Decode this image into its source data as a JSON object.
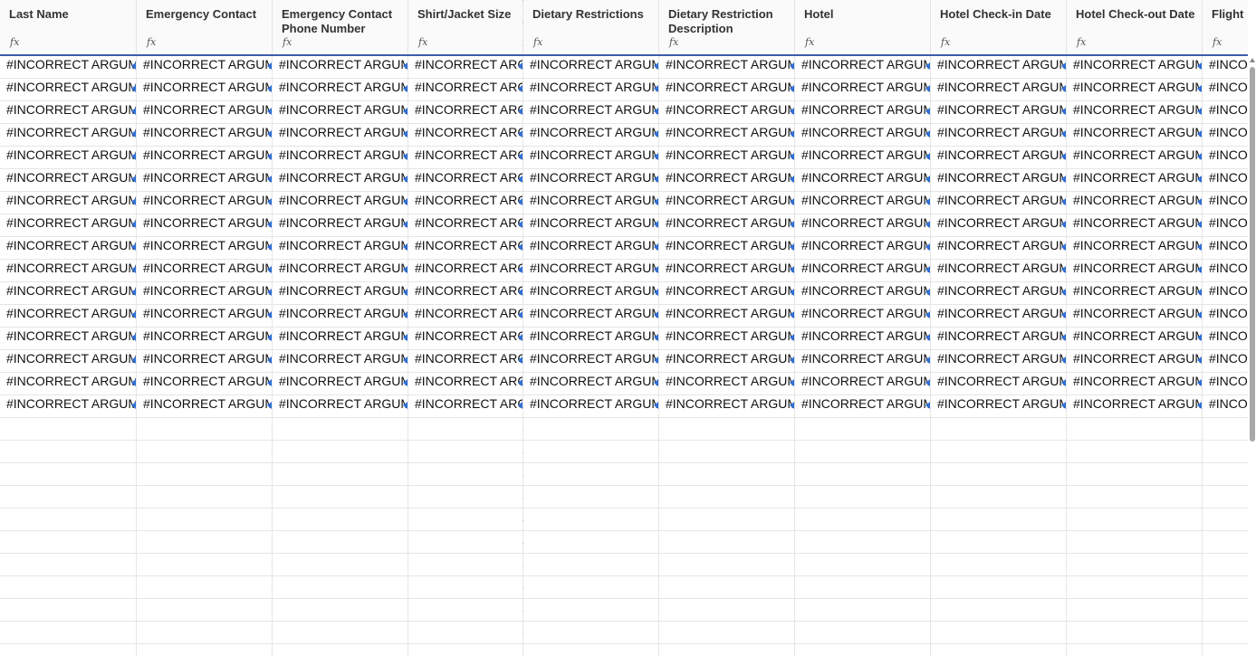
{
  "columns": [
    {
      "label": "Last Name",
      "fx": "fx"
    },
    {
      "label": "Emergency Contact",
      "fx": "fx"
    },
    {
      "label": "Emergency Contact Phone Number",
      "fx": "fx"
    },
    {
      "label": "Shirt/Jacket Size",
      "fx": "fx"
    },
    {
      "label": "Dietary Restrictions",
      "fx": "fx"
    },
    {
      "label": "Dietary Restriction Description",
      "fx": "fx"
    },
    {
      "label": "Hotel",
      "fx": "fx"
    },
    {
      "label": "Hotel Check-in Date",
      "fx": "fx"
    },
    {
      "label": "Hotel Check-out Date",
      "fx": "fx"
    },
    {
      "label": "Flight",
      "fx": "fx"
    }
  ],
  "cell_text": "#INCORRECT ARGUMENT",
  "filled_rows": 16,
  "empty_rows": 11,
  "colors": {
    "accent": "#3a5dae",
    "error_marker": "#2f6fd6"
  }
}
